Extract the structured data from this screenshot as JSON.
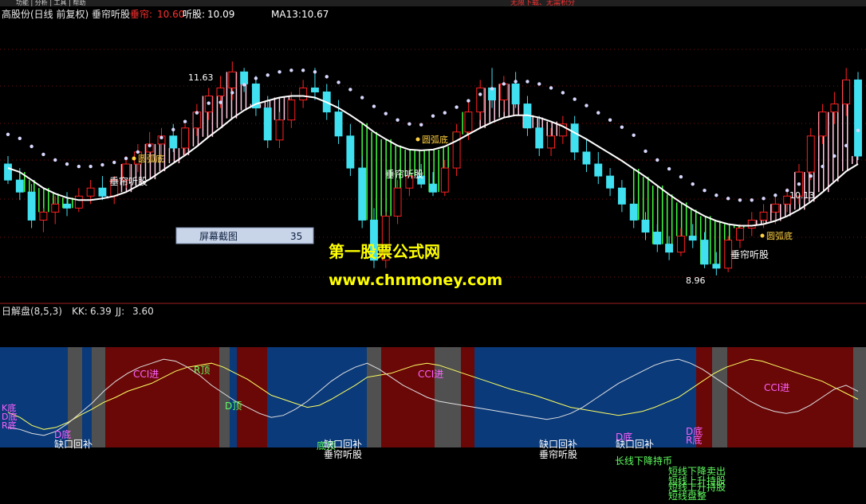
{
  "top_menu_partial": "功能 | 分析 | 工具 | 帮助",
  "top_red_text": "无限下载、无需积分",
  "upper_panel": {
    "title": "高股份(日线 前复权) 垂帘听股",
    "indicators": [
      {
        "label": "垂帘:",
        "value": "10.60",
        "color": "#ff3030"
      },
      {
        "label": "听股:",
        "value": "10.09",
        "color": "#ffffff"
      },
      {
        "label": "MA13:",
        "value": "10.67",
        "color": "#ffffff"
      }
    ],
    "high_marker": "11.63",
    "low_marker": "8.96",
    "mid_marker": "10.13",
    "label_chuilian": "垂帘听股",
    "label_yuanhudi": "圆弧底",
    "popup": {
      "label": "屏幕截图",
      "value": "35"
    },
    "watermark_title": "第一股票公式网",
    "watermark_url": "www.chnmoney.com"
  },
  "lower_panel": {
    "title": "日解盘(8,5,3)",
    "kk_label": "KK:",
    "kk_value": "6.39",
    "jj_label": "JJ:",
    "jj_value": "3.60",
    "signals": {
      "cci_in": "CCI进",
      "r_top": "R顶",
      "d_top": "D顶",
      "d_bottom": "D底",
      "r_bottom": "R底",
      "k_bottom": "K底",
      "gap_fill": "缺口回补",
      "chuilian": "垂帘听股",
      "bottom_top": "底顶",
      "long_down_hold": "长线下降持币",
      "short_down_sell": "短线下降卖出",
      "short_up_hold": "短线上升持股",
      "short_consol": "短线盘整"
    }
  },
  "colors": {
    "up_candle": "#ff2020",
    "down_candle": "#40e0f0",
    "green_fill": "#40ff40",
    "pink_fill": "#ffc8e0",
    "ma_line": "#ffffff",
    "dots": "#d8d8ff",
    "lower_blue": "#0a3a7a",
    "lower_red": "#6a0808",
    "lower_gray": "#505050",
    "watermark": "#ffff00"
  },
  "chart_data": {
    "type": "line",
    "candles": [
      [
        10.35,
        10.45,
        10.1,
        10.15
      ],
      [
        10.15,
        10.3,
        9.9,
        10.0
      ],
      [
        10.0,
        10.1,
        9.55,
        9.65
      ],
      [
        9.65,
        9.8,
        9.5,
        9.75
      ],
      [
        9.75,
        9.95,
        9.6,
        9.85
      ],
      [
        9.85,
        10.0,
        9.7,
        9.8
      ],
      [
        9.8,
        10.05,
        9.75,
        9.95
      ],
      [
        9.95,
        10.15,
        9.85,
        10.05
      ],
      [
        10.05,
        10.2,
        9.9,
        9.95
      ],
      [
        9.95,
        10.2,
        9.85,
        10.15
      ],
      [
        10.15,
        10.45,
        10.05,
        10.35
      ],
      [
        10.35,
        10.6,
        10.25,
        10.5
      ],
      [
        10.5,
        10.75,
        10.4,
        10.6
      ],
      [
        10.6,
        10.8,
        10.45,
        10.7
      ],
      [
        10.7,
        10.85,
        10.5,
        10.55
      ],
      [
        10.55,
        10.85,
        10.45,
        10.8
      ],
      [
        10.8,
        11.1,
        10.7,
        11.0
      ],
      [
        11.0,
        11.3,
        10.9,
        11.2
      ],
      [
        11.2,
        11.45,
        11.05,
        11.3
      ],
      [
        11.3,
        11.63,
        11.15,
        11.5
      ],
      [
        11.5,
        11.55,
        11.25,
        11.35
      ],
      [
        11.35,
        11.45,
        10.95,
        11.05
      ],
      [
        11.05,
        11.2,
        10.55,
        10.65
      ],
      [
        10.65,
        11.0,
        10.55,
        10.9
      ],
      [
        10.9,
        11.25,
        10.8,
        11.15
      ],
      [
        11.15,
        11.4,
        11.05,
        11.3
      ],
      [
        11.3,
        11.55,
        11.15,
        11.25
      ],
      [
        11.25,
        11.35,
        10.9,
        11.0
      ],
      [
        11.0,
        11.15,
        10.6,
        10.7
      ],
      [
        10.7,
        10.85,
        10.2,
        10.3
      ],
      [
        10.3,
        10.45,
        9.55,
        9.65
      ],
      [
        9.65,
        9.8,
        9.05,
        9.15
      ],
      [
        9.15,
        9.75,
        9.05,
        9.7
      ],
      [
        9.7,
        10.15,
        9.6,
        10.05
      ],
      [
        10.05,
        10.3,
        9.95,
        10.2
      ],
      [
        10.2,
        10.35,
        10.05,
        10.1
      ],
      [
        10.1,
        10.25,
        9.95,
        10.0
      ],
      [
        10.0,
        10.4,
        9.95,
        10.3
      ],
      [
        10.3,
        10.85,
        10.2,
        10.75
      ],
      [
        10.75,
        11.15,
        10.65,
        11.0
      ],
      [
        11.0,
        11.4,
        10.9,
        11.3
      ],
      [
        11.3,
        11.55,
        11.05,
        11.15
      ],
      [
        11.15,
        11.45,
        11.0,
        11.35
      ],
      [
        11.35,
        11.5,
        11.05,
        11.1
      ],
      [
        11.1,
        11.2,
        10.7,
        10.8
      ],
      [
        10.8,
        10.95,
        10.45,
        10.55
      ],
      [
        10.55,
        10.8,
        10.45,
        10.7
      ],
      [
        10.7,
        10.95,
        10.6,
        10.85
      ],
      [
        10.85,
        10.95,
        10.4,
        10.5
      ],
      [
        10.5,
        10.65,
        10.25,
        10.35
      ],
      [
        10.35,
        10.5,
        10.1,
        10.2
      ],
      [
        10.2,
        10.3,
        9.95,
        10.05
      ],
      [
        10.05,
        10.15,
        9.75,
        9.85
      ],
      [
        9.85,
        9.95,
        9.55,
        9.65
      ],
      [
        9.65,
        9.75,
        9.4,
        9.5
      ],
      [
        9.5,
        9.6,
        9.25,
        9.35
      ],
      [
        9.35,
        9.45,
        9.15,
        9.25
      ],
      [
        9.25,
        9.55,
        9.2,
        9.45
      ],
      [
        9.45,
        9.6,
        9.3,
        9.4
      ],
      [
        9.4,
        9.5,
        9.05,
        9.1
      ],
      [
        9.1,
        9.25,
        8.96,
        9.05
      ],
      [
        9.05,
        9.45,
        9.0,
        9.4
      ],
      [
        9.4,
        9.6,
        9.3,
        9.55
      ],
      [
        9.55,
        9.75,
        9.45,
        9.65
      ],
      [
        9.65,
        9.85,
        9.55,
        9.75
      ],
      [
        9.75,
        9.95,
        9.6,
        9.85
      ],
      [
        9.85,
        10.05,
        9.75,
        9.95
      ],
      [
        9.95,
        10.35,
        9.85,
        10.25
      ],
      [
        10.25,
        10.8,
        10.15,
        10.7
      ],
      [
        10.7,
        11.1,
        10.6,
        11.0
      ],
      [
        11.0,
        11.25,
        10.85,
        11.1
      ],
      [
        11.1,
        11.55,
        10.95,
        11.4
      ],
      [
        11.4,
        11.5,
        10.4,
        10.45
      ]
    ],
    "ma13": [
      10.3,
      10.25,
      10.15,
      10.05,
      9.98,
      9.93,
      9.9,
      9.9,
      9.92,
      9.95,
      10.0,
      10.08,
      10.16,
      10.26,
      10.36,
      10.46,
      10.57,
      10.69,
      10.8,
      10.92,
      11.02,
      11.1,
      11.14,
      11.18,
      11.2,
      11.2,
      11.18,
      11.12,
      11.05,
      10.96,
      10.86,
      10.75,
      10.66,
      10.58,
      10.53,
      10.52,
      10.53,
      10.57,
      10.64,
      10.72,
      10.8,
      10.87,
      10.93,
      10.96,
      10.96,
      10.93,
      10.88,
      10.82,
      10.74,
      10.66,
      10.57,
      10.48,
      10.39,
      10.29,
      10.19,
      10.08,
      9.97,
      9.87,
      9.78,
      9.7,
      9.64,
      9.6,
      9.58,
      9.58,
      9.6,
      9.64,
      9.7,
      9.78,
      9.88,
      10.0,
      10.13,
      10.26,
      10.35
    ],
    "lower_kk": [
      35,
      30,
      22,
      18,
      20,
      25,
      32,
      38,
      45,
      50,
      56,
      60,
      64,
      70,
      76,
      80,
      82,
      84,
      80,
      74,
      68,
      60,
      52,
      48,
      44,
      40,
      42,
      48,
      55,
      62,
      70,
      72,
      74,
      78,
      82,
      84,
      82,
      78,
      74,
      70,
      66,
      62,
      58,
      55,
      52,
      48,
      44,
      40,
      38,
      36,
      34,
      32,
      34,
      36,
      40,
      45,
      50,
      58,
      66,
      74,
      80,
      84,
      88,
      86,
      82,
      78,
      74,
      70,
      66,
      60,
      54,
      48
    ],
    "lower_jj": [
      20,
      18,
      14,
      12,
      16,
      24,
      34,
      44,
      56,
      66,
      74,
      80,
      84,
      88,
      86,
      80,
      72,
      62,
      54,
      46,
      40,
      34,
      30,
      32,
      38,
      46,
      56,
      66,
      74,
      80,
      84,
      78,
      70,
      62,
      56,
      50,
      46,
      44,
      42,
      40,
      38,
      36,
      34,
      32,
      30,
      28,
      30,
      34,
      40,
      48,
      56,
      64,
      70,
      76,
      82,
      86,
      88,
      84,
      78,
      70,
      62,
      54,
      46,
      40,
      36,
      34,
      36,
      42,
      50,
      58,
      62,
      56
    ]
  }
}
